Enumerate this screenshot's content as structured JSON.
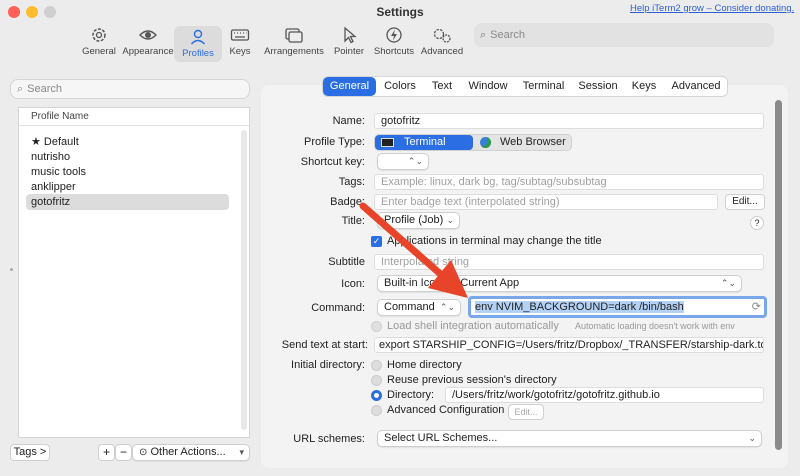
{
  "window": {
    "title": "Settings",
    "promo_link": "Help iTerm2 grow – Consider donating."
  },
  "toolbar": {
    "items": [
      {
        "label": "General",
        "icon": "gear-icon"
      },
      {
        "label": "Appearance",
        "icon": "eye-icon"
      },
      {
        "label": "Profiles",
        "icon": "person-icon",
        "selected": true
      },
      {
        "label": "Keys",
        "icon": "keyboard-icon"
      },
      {
        "label": "Arrangements",
        "icon": "windows-icon"
      },
      {
        "label": "Pointer",
        "icon": "pointer-icon"
      },
      {
        "label": "Shortcuts",
        "icon": "lightning-icon"
      },
      {
        "label": "Advanced",
        "icon": "gears-icon"
      }
    ],
    "search_placeholder": "Search"
  },
  "sidebar": {
    "search_placeholder": "Search",
    "column_header": "Profile Name",
    "profiles": [
      "★ Default",
      "nutrisho",
      "music tools",
      "anklipper",
      "gotofritz"
    ],
    "selected_index": 4,
    "tags_button": "Tags >",
    "add_button": "+",
    "remove_button": "−",
    "other_actions": "Other Actions..."
  },
  "tabs": [
    "General",
    "Colors",
    "Text",
    "Window",
    "Terminal",
    "Session",
    "Keys",
    "Advanced"
  ],
  "form": {
    "name_label": "Name:",
    "name_value": "gotofritz",
    "profile_type_label": "Profile Type:",
    "profile_type_terminal": "Terminal",
    "profile_type_web": "Web Browser",
    "shortcut_label": "Shortcut key:",
    "tags_label": "Tags:",
    "tags_placeholder": "Example: linux, dark bg, tag/subtag/subsubtag",
    "badge_label": "Badge:",
    "badge_placeholder": "Enter badge text (interpolated string)",
    "badge_edit": "Edit...",
    "title_label": "Title:",
    "title_value": "Profile (Job)",
    "title_help": "?",
    "apps_change_title": "Applications in terminal may change the title",
    "subtitle_label": "Subtitle",
    "subtitle_placeholder": "Interpolated string",
    "icon_label": "Icon:",
    "icon_value": "Built-in Icon for Current App",
    "command_label": "Command:",
    "command_type": "Command",
    "command_value": "env NVIM_BACKGROUND=dark /bin/bash",
    "shell_integration": "Load shell integration automatically",
    "shell_integration_note": "Automatic loading doesn't work with env",
    "send_text_label": "Send text at start:",
    "send_text_value": "export STARSHIP_CONFIG=/Users/fritz/Dropbox/_TRANSFER/starship-dark.toml  &&",
    "initial_dir_label": "Initial directory:",
    "dir_home": "Home directory",
    "dir_reuse": "Reuse previous session's directory",
    "dir_directory": "Directory:",
    "dir_path": "/Users/fritz/work/gotofritz/gotofritz.github.io",
    "dir_advanced": "Advanced Configuration",
    "dir_advanced_edit": "Edit...",
    "url_label": "URL schemes:",
    "url_value": "Select URL Schemes..."
  },
  "colors": {
    "accent": "#2b6de3",
    "arrow": "#e8442a"
  }
}
